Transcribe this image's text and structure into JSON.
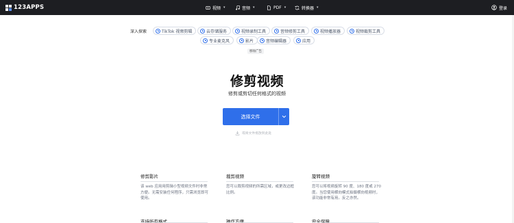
{
  "header": {
    "logo_text": "123APPS",
    "nav": [
      {
        "label": "视频",
        "icon": "video-icon"
      },
      {
        "label": "音频",
        "icon": "music-note-icon"
      },
      {
        "label": "PDF",
        "icon": "document-icon"
      },
      {
        "label": "转换器",
        "icon": "convert-icon"
      }
    ],
    "login_label": "登录"
  },
  "explore": {
    "label": "深入探索",
    "chips": [
      "TikTok 视频剪辑",
      "云存储服务",
      "视频录制工具",
      "音频修剪工具",
      "视频播放器",
      "视频裁剪工具",
      "专业麦克风",
      "影片",
      "音频编辑器",
      "应用"
    ],
    "remove_ad": "移除广告"
  },
  "hero": {
    "title": "修剪视频",
    "subtitle": "修剪或剪切任何格式的视频",
    "choose_button": "选择文件",
    "drop_hint": "或将文件拖放到此处"
  },
  "features": [
    {
      "title": "修剪影片",
      "text": "该 web 应用用剪辑小型视频文件时非常方便。无需安装任何程序，只需浏览即可使用。"
    },
    {
      "title": "裁剪视频",
      "text": "您可以裁剪视频的所需区域，或更改边框比例。"
    },
    {
      "title": "旋转视频",
      "text": "您可以将视频旋转 90 度、180 度或 270 度。当您使用横向模式拍摄横向视频时，该功能非常有用。反之亦然。"
    }
  ],
  "features_row2": [
    "支持所有格式",
    "操作方便",
    "安全保障"
  ],
  "colors": {
    "accent": "#2f6fea",
    "topbar": "#1d1e22"
  }
}
